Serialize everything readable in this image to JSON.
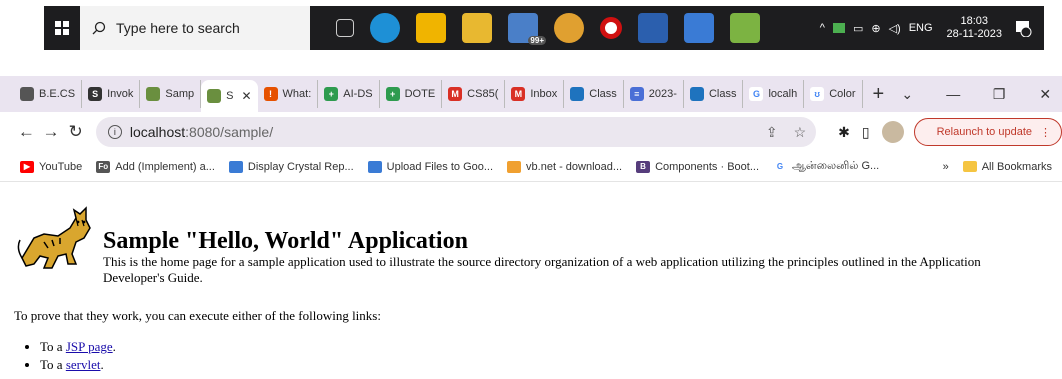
{
  "taskbar": {
    "search_placeholder": "Type here to search",
    "badge": "99+",
    "lang": "ENG",
    "time": "18:03",
    "date": "28-11-2023",
    "notification_count": "1"
  },
  "tabs": [
    {
      "label": "B.E.CS",
      "icon": "chrome-icon",
      "color": "#555555",
      "glyph": ""
    },
    {
      "label": "Invok",
      "icon": "document-icon",
      "color": "#333333",
      "glyph": "S"
    },
    {
      "label": "Samp",
      "icon": "image-icon",
      "color": "#6a8f3f",
      "glyph": ""
    },
    {
      "label": "S",
      "icon": "image-icon",
      "color": "#6a8f3f",
      "glyph": "",
      "active": true
    },
    {
      "label": "What:",
      "icon": "info-icon",
      "color": "#e65100",
      "glyph": "!"
    },
    {
      "label": "AI-DS",
      "icon": "plus-icon",
      "color": "#2e9b4f",
      "glyph": "+"
    },
    {
      "label": "DOTE",
      "icon": "plus-icon",
      "color": "#2e9b4f",
      "glyph": "+"
    },
    {
      "label": "CS85(",
      "icon": "gmail-icon",
      "color": "#d93025",
      "glyph": "M"
    },
    {
      "label": "Inbox",
      "icon": "gmail-icon",
      "color": "#d93025",
      "glyph": "M"
    },
    {
      "label": "Class",
      "icon": "classroom-icon",
      "color": "#1e73be",
      "glyph": ""
    },
    {
      "label": "2023-",
      "icon": "forms-icon",
      "color": "#4a6fd6",
      "glyph": "≡"
    },
    {
      "label": "Class",
      "icon": "classroom-icon",
      "color": "#1e73be",
      "glyph": ""
    },
    {
      "label": "localh",
      "icon": "google-icon",
      "color": "#ffffff",
      "glyph": "G"
    },
    {
      "label": "Color",
      "icon": "cup-icon",
      "color": "#ffffff",
      "glyph": "ʊ"
    }
  ],
  "address": {
    "host": "localhost",
    "path": ":8080/sample/"
  },
  "relaunch_label": "Relaunch to update",
  "bookmarks": [
    {
      "label": "YouTube",
      "icon": "youtube-icon",
      "color": "#ff0000",
      "glyph": "▶"
    },
    {
      "label": "Add (Implement) a...",
      "icon": "stack-icon",
      "color": "#555555",
      "glyph": "Fo"
    },
    {
      "label": "Display Crystal Rep...",
      "icon": "globe-icon",
      "color": "#3a7bd5",
      "glyph": ""
    },
    {
      "label": "Upload Files to Goo...",
      "icon": "globe-icon",
      "color": "#3a7bd5",
      "glyph": ""
    },
    {
      "label": "vb.net - download...",
      "icon": "pen-icon",
      "color": "#f0a030",
      "glyph": ""
    },
    {
      "label": "Components · Boot...",
      "icon": "bootstrap-icon",
      "color": "#563d7c",
      "glyph": "B"
    },
    {
      "label": "ஆன்லைனில் G...",
      "icon": "google-icon",
      "color": "#ffffff",
      "glyph": "G"
    }
  ],
  "all_bookmarks": "All Bookmarks",
  "page": {
    "title": "Sample \"Hello, World\" Application",
    "intro": "This is the home page for a sample application used to illustrate the source directory organization of a web application utilizing the principles outlined in the Application Developer's Guide.",
    "prove": "To prove that they work, you can execute either of the following links:",
    "link1_prefix": "To a ",
    "link1_text": "JSP page",
    "link1_suffix": ".",
    "link2_prefix": "To a ",
    "link2_text": "servlet",
    "link2_suffix": "."
  }
}
